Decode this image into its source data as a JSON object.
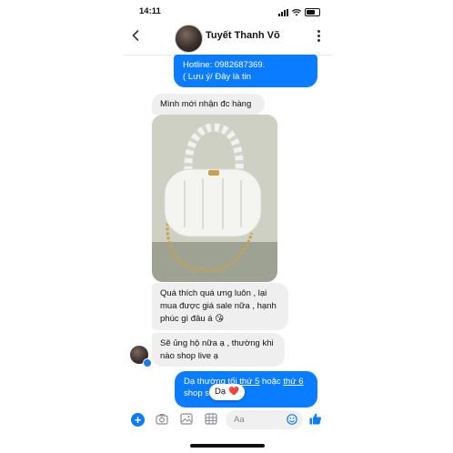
{
  "status_bar": {
    "time": "14:11"
  },
  "header": {
    "contact_name": "Tuyết Thanh Võ",
    "back_icon": "chevron-left-icon",
    "more_icon": "more-vertical-icon"
  },
  "messages": [
    {
      "dir": "out",
      "lines": [
        "Hotline: 0982687369.",
        "( Lưu ý/ Đây là tin"
      ]
    },
    {
      "dir": "in",
      "text": "Mình mới nhận đc hàng"
    },
    {
      "dir": "in",
      "type": "photo",
      "description": "white handbag"
    },
    {
      "dir": "in",
      "lines": [
        "Quá thích quá ưng luôn , lại",
        "mua được giá sale nữa , hạnh",
        "phúc gì đâu á 😘"
      ]
    },
    {
      "dir": "in",
      "lines": [
        "Sẽ ủng hộ nữa ạ , thường khi",
        "nào shop live ạ"
      ]
    },
    {
      "dir": "out",
      "line1_a": "Dạ thường tối ",
      "line1_b": "thứ 5",
      "line1_c": " hoặc ",
      "line1_d": "thứ 6",
      "line2": "shop s",
      "reaction": "Dạ",
      "reaction_emoji": "❤️"
    }
  ],
  "composer": {
    "placeholder": "Aa",
    "plus_label": "+"
  },
  "colors": {
    "accent": "#0a7cff",
    "incoming_bubble": "#efefef"
  }
}
